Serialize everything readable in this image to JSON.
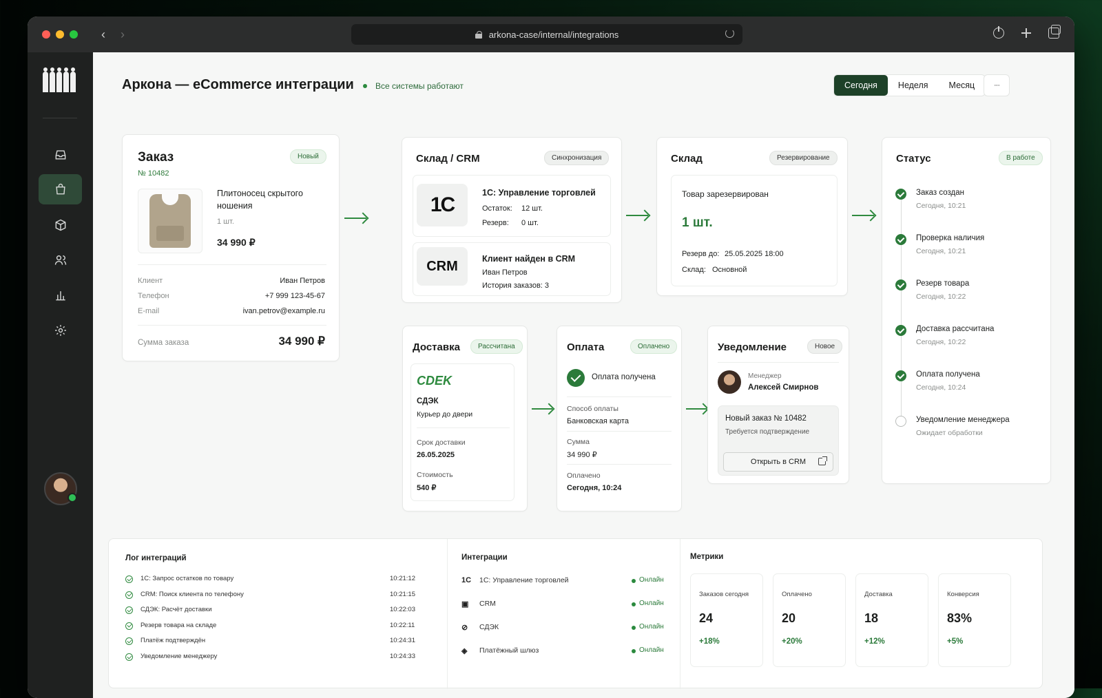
{
  "browser": {
    "url": "arkona-case/internal/integrations",
    "traffic_colors": [
      "#ff5f57",
      "#febc2e",
      "#28c840"
    ]
  },
  "header": {
    "title": "Аркона — eCommerce интеграции",
    "status": "Все системы работают",
    "periods": [
      "Сегодня",
      "Неделя",
      "Месяц"
    ],
    "active_period": "Сегодня",
    "more": "···"
  },
  "sidebar": {
    "items": [
      {
        "name": "integrations",
        "icon": "inbox-icon"
      },
      {
        "name": "orders",
        "icon": "shopping-bag-icon",
        "active": true
      },
      {
        "name": "products",
        "icon": "box-icon"
      },
      {
        "name": "customers",
        "icon": "users-icon"
      },
      {
        "name": "analytics",
        "icon": "bar-chart-icon"
      },
      {
        "name": "settings",
        "icon": "gear-icon"
      }
    ]
  },
  "order": {
    "title": "Заказ",
    "badge": "Новый",
    "number": "№ 10482",
    "product_name": "Плитоносец скрытого ношения",
    "qty": "1 шт.",
    "price": "34 990 ₽",
    "rows": [
      {
        "label": "Клиент",
        "value": "Иван Петров"
      },
      {
        "label": "Телефон",
        "value": "+7 999 123-45-67"
      },
      {
        "label": "E-mail",
        "value": "ivan.petrov@example.ru"
      }
    ],
    "total_label": "Сумма заказа",
    "total_value": "34 990 ₽"
  },
  "sklad_crm": {
    "title": "Склад / CRM",
    "badge": "Синхронизация",
    "onec": {
      "logo": "1С",
      "title": "1С: Управление торговлей",
      "stock_label": "Остаток:",
      "stock_value": "12 шт.",
      "reserve_label": "Резерв:",
      "reserve_value": "0 шт."
    },
    "crm": {
      "logo": "CRM",
      "title": "Клиент найден в CRM",
      "client": "Иван Петров",
      "history": "История заказов: 3"
    }
  },
  "warehouse": {
    "title": "Склад",
    "badge": "Резервирование",
    "reserved_text": "Товар зарезервирован",
    "qty": "1 шт.",
    "until_label": "Резерв до:",
    "until_value": "25.05.2025 18:00",
    "store_label": "Склад:",
    "store_value": "Основной"
  },
  "status": {
    "title": "Статус",
    "badge": "В работе",
    "steps": [
      {
        "label": "Заказ создан",
        "time": "Сегодня, 10:21",
        "done": true
      },
      {
        "label": "Проверка наличия",
        "time": "Сегодня, 10:21",
        "done": true
      },
      {
        "label": "Резерв товара",
        "time": "Сегодня, 10:22",
        "done": true
      },
      {
        "label": "Доставка рассчитана",
        "time": "Сегодня, 10:22",
        "done": true
      },
      {
        "label": "Оплата получена",
        "time": "Сегодня, 10:24",
        "done": true
      },
      {
        "label": "Уведомление менеджера",
        "time": "Ожидает обработки",
        "done": false
      }
    ]
  },
  "delivery": {
    "title": "Доставка",
    "badge": "Рассчитана",
    "logo": "CDEK",
    "service": "СДЭК",
    "type": "Курьер до двери",
    "term_label": "Срок доставки",
    "term_value": "26.05.2025",
    "cost_label": "Стоимость",
    "cost_value": "540 ₽"
  },
  "payment": {
    "title": "Оплата",
    "badge": "Оплачено",
    "received": "Оплата получена",
    "method_label": "Способ оплаты",
    "method_value": "Банковская карта",
    "sum_label": "Сумма",
    "sum_value": "34 990 ₽",
    "paid_label": "Оплачено",
    "paid_value": "Сегодня, 10:24"
  },
  "notification": {
    "title": "Уведомление",
    "badge": "Новое",
    "role": "Менеджер",
    "manager": "Алексей Смирнов",
    "message_title": "Новый заказ № 10482",
    "message_sub": "Требуется подтверждение",
    "button": "Открыть в CRM"
  },
  "log": {
    "title": "Лог интеграций",
    "entries": [
      {
        "text": "1С: Запрос остатков по товару",
        "time": "10:21:12"
      },
      {
        "text": "CRM: Поиск клиента по телефону",
        "time": "10:21:15"
      },
      {
        "text": "СДЭК: Расчёт доставки",
        "time": "10:22:03"
      },
      {
        "text": "Резерв товара на складе",
        "time": "10:22:11"
      },
      {
        "text": "Платёж подтверждён",
        "time": "10:24:31"
      },
      {
        "text": "Уведомление менеджеру",
        "time": "10:24:33"
      }
    ]
  },
  "integrations": {
    "title": "Интеграции",
    "items": [
      {
        "name": "1С: Управление торговлей",
        "status": "Онлайн",
        "icon": "1c-icon"
      },
      {
        "name": "CRM",
        "status": "Онлайн",
        "icon": "crm-icon"
      },
      {
        "name": "СДЭК",
        "status": "Онлайн",
        "icon": "delivery-icon"
      },
      {
        "name": "Платёжный шлюз",
        "status": "Онлайн",
        "icon": "payment-icon"
      }
    ]
  },
  "metrics": {
    "title": "Метрики",
    "items": [
      {
        "label": "Заказов сегодня",
        "value": "24",
        "delta": "+18%"
      },
      {
        "label": "Оплачено",
        "value": "20",
        "delta": "+20%"
      },
      {
        "label": "Доставка",
        "value": "18",
        "delta": "+12%"
      },
      {
        "label": "Конверсия",
        "value": "83%",
        "delta": "+5%"
      }
    ]
  },
  "colors": {
    "accent": "#2b7a3a",
    "dark_green": "#1d4128",
    "sidebar": "#1f2120"
  }
}
